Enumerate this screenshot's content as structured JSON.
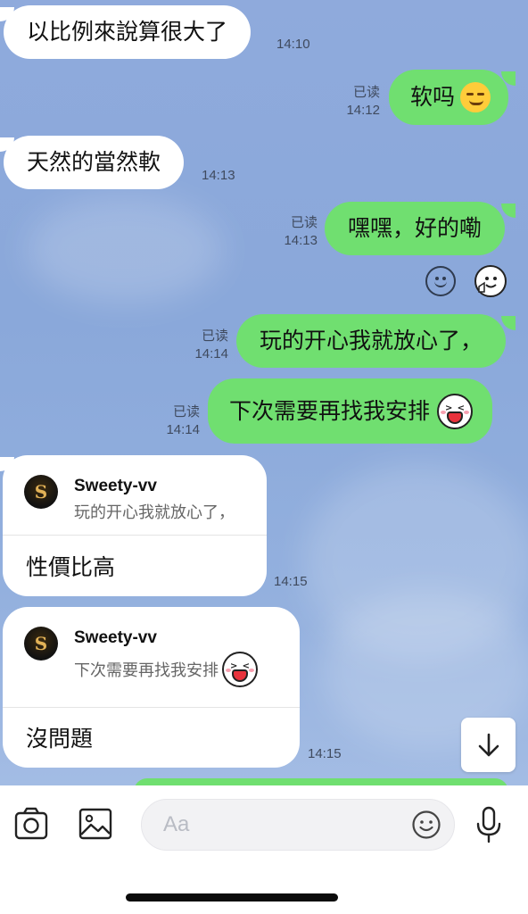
{
  "messages": [
    {
      "side": "in",
      "text": "以比例來說算很大了",
      "time": "14:10"
    },
    {
      "side": "out",
      "text": "软吗",
      "emoji": "smirking-face",
      "read": "已读",
      "time": "14:12"
    },
    {
      "side": "in",
      "text": "天然的當然軟",
      "time": "14:13"
    },
    {
      "side": "out",
      "text": "嘿嘿，好的嘞",
      "read": "已读",
      "time": "14:13"
    },
    {
      "side": "out",
      "text": "玩的开心我就放心了，",
      "read": "已读",
      "time": "14:14"
    },
    {
      "side": "out",
      "text": "下次需要再找我安排",
      "sticker": "laughing-sticker",
      "read": "已读",
      "time": "14:14"
    }
  ],
  "replies": [
    {
      "author": "Sweety-vv",
      "avatar_letter": "S",
      "quoted": "玩的开心我就放心了，",
      "text": "性價比高",
      "time": "14:15"
    },
    {
      "author": "Sweety-vv",
      "avatar_letter": "S",
      "quoted": "下次需要再找我安排",
      "text": "沒問題",
      "time": "14:15"
    }
  ],
  "input": {
    "placeholder": "Aa"
  },
  "icons": {
    "camera": "camera-icon",
    "gallery": "image-icon",
    "emoji": "smiley-icon",
    "mic": "microphone-icon",
    "scroll": "arrow-down-icon"
  },
  "colors": {
    "background": "#8faadc",
    "outgoing": "#70df70",
    "incoming": "#ffffff"
  }
}
